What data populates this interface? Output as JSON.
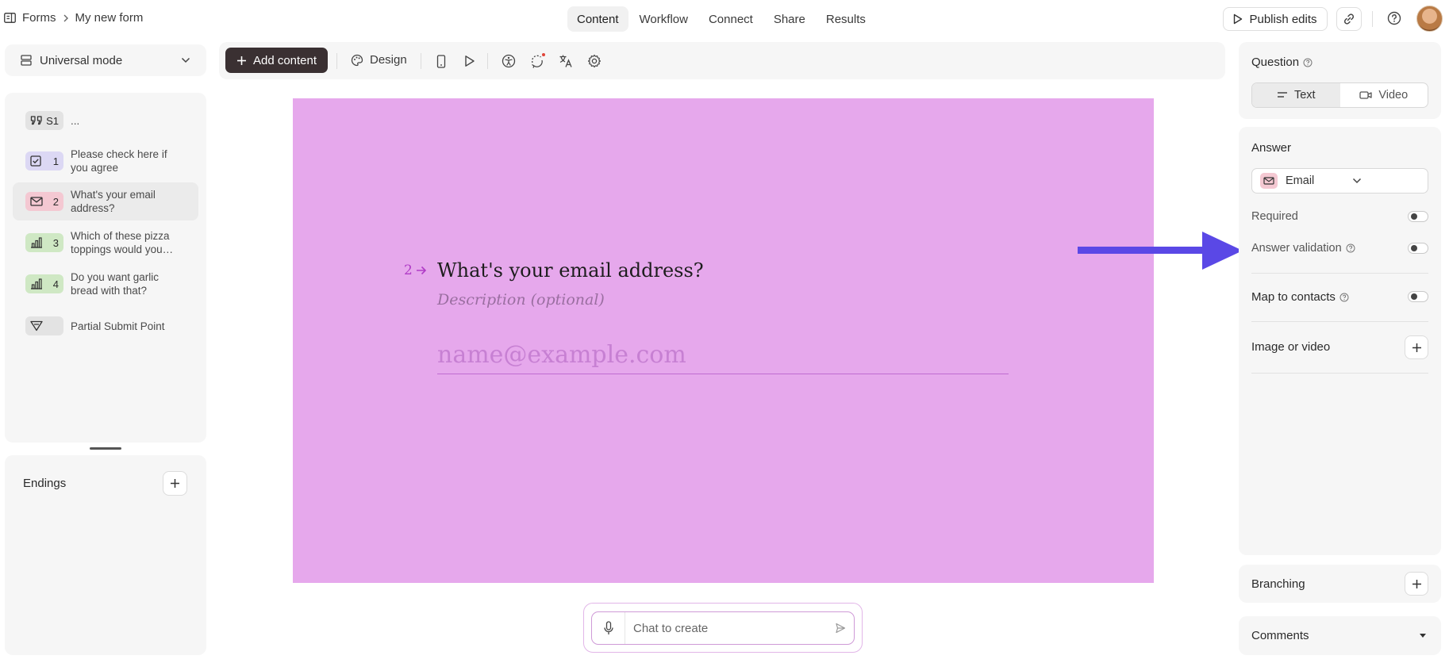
{
  "breadcrumb": {
    "root": "Forms",
    "current": "My new form"
  },
  "nav": {
    "tabs": [
      "Content",
      "Workflow",
      "Connect",
      "Share",
      "Results"
    ],
    "active": "Content"
  },
  "header": {
    "publish_label": "Publish edits"
  },
  "sidebar": {
    "mode_label": "Universal mode",
    "questions": [
      {
        "badge": "S1",
        "text": "...",
        "color": "#e3e3e3",
        "icon": "quote-icon"
      },
      {
        "badge": "1",
        "text": "Please check here if you agree",
        "color": "#dcd8f4",
        "icon": "checkbox-icon"
      },
      {
        "badge": "2",
        "text": "What's your email address?",
        "color": "#f4c8d2",
        "icon": "email-icon"
      },
      {
        "badge": "3",
        "text": "Which of these pizza toppings would you…",
        "color": "#cfe8c4",
        "icon": "bar-chart-icon"
      },
      {
        "badge": "4",
        "text": "Do you want garlic bread with that?",
        "color": "#cfe8c4",
        "icon": "bar-chart-icon"
      },
      {
        "badge": "",
        "text": "Partial Submit Point",
        "color": "#e3e3e3",
        "icon": "filter-icon"
      }
    ],
    "endings_label": "Endings"
  },
  "toolbar": {
    "add_content_label": "Add content",
    "design_label": "Design"
  },
  "canvas": {
    "background": "#e6a8ec",
    "question_number": "2",
    "question_title": "What's your email address?",
    "description_placeholder": "Description (optional)",
    "input_placeholder": "name@example.com"
  },
  "chat": {
    "placeholder": "Chat to create"
  },
  "panel": {
    "question_label": "Question",
    "text_tab": "Text",
    "video_tab": "Video",
    "answer_label": "Answer",
    "answer_type": "Email",
    "required_label": "Required",
    "validation_label": "Answer validation",
    "map_contacts_label": "Map to contacts",
    "image_video_label": "Image or video",
    "branching_label": "Branching",
    "comments_label": "Comments"
  },
  "colors": {
    "accent_arrow": "#5a48e6",
    "canvas": "#e6a8ec",
    "add_button": "#3a3032"
  }
}
